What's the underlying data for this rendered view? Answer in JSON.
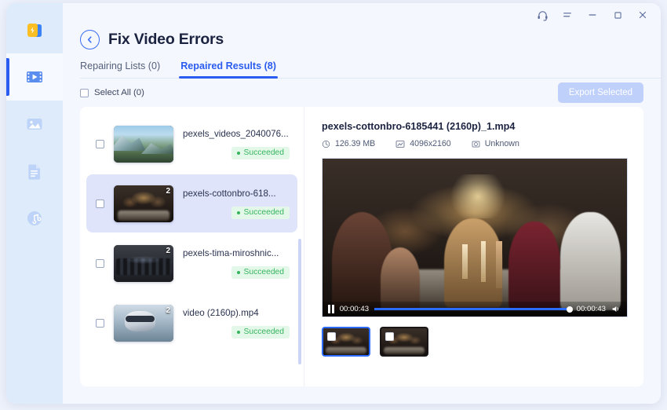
{
  "sidebar": {
    "items": [
      {
        "name": "app-logo",
        "icon": "app-logo-icon",
        "active": false
      },
      {
        "name": "video-repair",
        "icon": "video-icon",
        "active": true
      },
      {
        "name": "photo-repair",
        "icon": "image-icon",
        "active": false
      },
      {
        "name": "file-repair",
        "icon": "document-icon",
        "active": false
      },
      {
        "name": "audio-repair",
        "icon": "music-icon",
        "active": false
      }
    ]
  },
  "titlebar": {
    "buttons": [
      {
        "name": "support-headset",
        "icon": "headset-icon",
        "glyph": "⚈"
      },
      {
        "name": "menu",
        "icon": "hamburger-menu-icon",
        "glyph": "≡"
      },
      {
        "name": "minimize",
        "icon": "minimize-icon",
        "glyph": "−"
      },
      {
        "name": "maximize",
        "icon": "maximize-icon",
        "glyph": "□"
      },
      {
        "name": "close",
        "icon": "close-icon",
        "glyph": "×"
      }
    ]
  },
  "header": {
    "back_icon": "chevron-left-icon",
    "title": "Fix Video Errors"
  },
  "tabs": [
    {
      "label": "Repairing Lists (0)",
      "active": false
    },
    {
      "label": "Repaired Results (8)",
      "active": true
    }
  ],
  "toolbar": {
    "select_all_label": "Select All (0)",
    "export_label": "Export Selected",
    "export_disabled": true
  },
  "file_list": [
    {
      "filename": "pexels_videos_2040076...",
      "status": "Succeeded",
      "badge": "",
      "selected": false,
      "scene": "mountain"
    },
    {
      "filename": "pexels-cottonbro-618...",
      "status": "Succeeded",
      "badge": "2",
      "selected": true,
      "scene": "dinner"
    },
    {
      "filename": "pexels-tima-miroshnic...",
      "status": "Succeeded",
      "badge": "2",
      "selected": false,
      "scene": "cinema"
    },
    {
      "filename": "video (2160p).mp4",
      "status": "Succeeded",
      "badge": "2",
      "selected": false,
      "scene": "vr"
    }
  ],
  "detail": {
    "title": "pexels-cottonbro-6185441 (2160p)_1.mp4",
    "meta": [
      {
        "icon": "file-size-icon",
        "value": "126.39 MB"
      },
      {
        "icon": "resolution-icon",
        "value": "4096x2160"
      },
      {
        "icon": "camera-icon",
        "value": "Unknown"
      }
    ],
    "player": {
      "state_icon": "pause-icon",
      "current_time": "00:00:43",
      "total_time": "00:00:43",
      "progress_percent": 100,
      "volume_icon": "volume-icon"
    },
    "thumbnails": [
      {
        "name": "clip-thumb-1",
        "active": true
      },
      {
        "name": "clip-thumb-2",
        "active": false
      }
    ]
  },
  "colors": {
    "accent": "#2b5cf0",
    "success": "#36b45e",
    "sidebar_bg": "#deebfb",
    "page_bg": "#f4f7fe",
    "selected_row": "#dfe4fb"
  }
}
